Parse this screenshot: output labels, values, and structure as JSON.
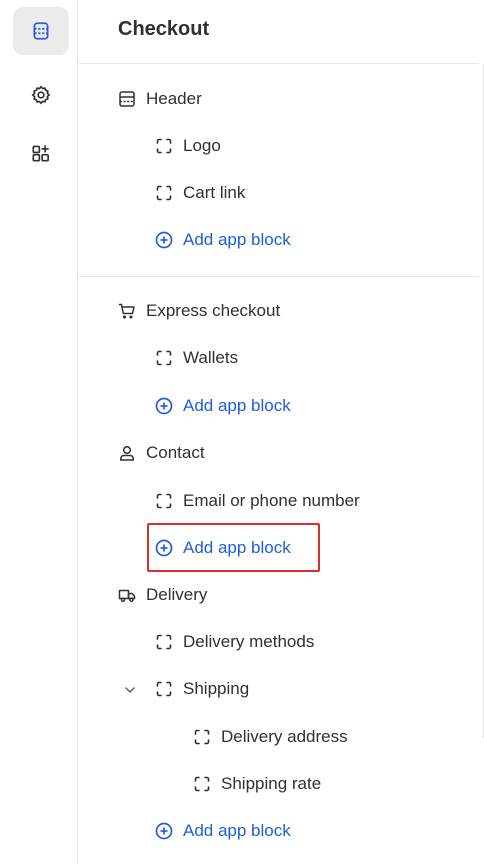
{
  "panel": {
    "title": "Checkout"
  },
  "rail": {
    "items": [
      {
        "icon": "sections-icon",
        "active": true
      },
      {
        "icon": "gear-icon",
        "active": false
      },
      {
        "icon": "apps-icon",
        "active": false
      }
    ]
  },
  "sections": {
    "header": {
      "label": "Header",
      "icon": "header-layout-icon",
      "blocks": [
        "Logo",
        "Cart link"
      ],
      "add_label": "Add app block"
    },
    "express": {
      "label": "Express checkout",
      "icon": "cart-icon",
      "blocks": [
        "Wallets"
      ],
      "add_label": "Add app block"
    },
    "contact": {
      "label": "Contact",
      "icon": "person-icon",
      "blocks": [
        "Email or phone number"
      ],
      "add_label": "Add app block"
    },
    "delivery": {
      "label": "Delivery",
      "icon": "truck-icon",
      "blocks": [
        "Delivery methods",
        "Shipping"
      ],
      "shipping_children": [
        "Delivery address",
        "Shipping rate"
      ],
      "add_label": "Add app block"
    }
  },
  "colors": {
    "accent": "#1f5ed8",
    "highlight": "#d9302c"
  }
}
